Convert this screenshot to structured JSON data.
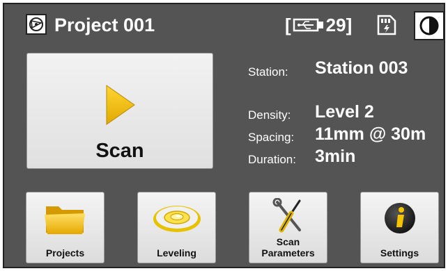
{
  "header": {
    "project_title": "Project 001",
    "storage_open": "[",
    "storage_count": "29",
    "storage_close": "]"
  },
  "scan_button": {
    "label": "Scan"
  },
  "info": {
    "station_label": "Station:",
    "station_value": "Station 003",
    "density_label": "Density:",
    "density_value": "Level 2",
    "spacing_label": "Spacing:",
    "spacing_value": "11mm @ 30m",
    "duration_label": "Duration:",
    "duration_value": "3min"
  },
  "tiles": {
    "projects": "Projects",
    "leveling": "Leveling",
    "scan_params_line1": "Scan",
    "scan_params_line2": "Parameters",
    "settings": "Settings"
  },
  "icons": [
    "project-icon",
    "usb-drive-icon",
    "sd-card-icon",
    "contrast-icon",
    "play-icon",
    "folder-icon",
    "level-icon",
    "tools-icon",
    "info-icon"
  ],
  "colors": {
    "background": "#545454",
    "accent": "#f5c400"
  }
}
